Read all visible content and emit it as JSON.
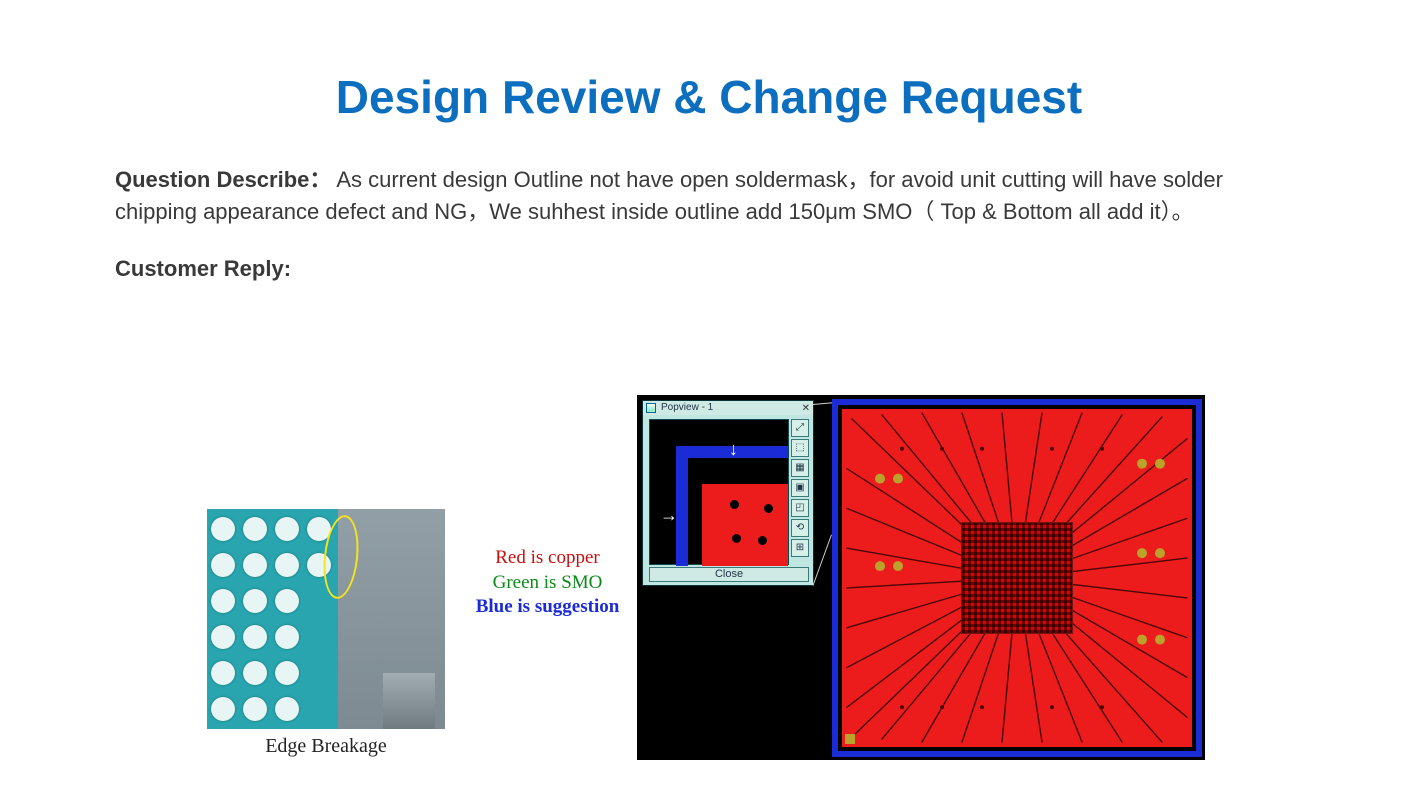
{
  "title": "Design Review & Change Request",
  "question_label": "Question Describe：",
  "question_text": "As current design Outline not have open soldermask，for avoid unit cutting will have solder chipping appearance defect and NG，We suhhest inside outline add 150μm SMO（ Top & Bottom all add it）。",
  "customer_reply_label": "Customer Reply:",
  "photo_caption": "Edge Breakage",
  "legend": {
    "copper": "Red is copper",
    "smo": "Green is SMO",
    "suggestion": "Blue is suggestion"
  },
  "popview": {
    "title": "Popview - 1",
    "close_x": "✕",
    "close_label": "Close",
    "tool_glyphs": [
      "⤢",
      "⬚",
      "▦",
      "▣",
      "◰",
      "⟲",
      "⊞"
    ]
  },
  "arrows": {
    "down": "↓",
    "right": "→"
  }
}
